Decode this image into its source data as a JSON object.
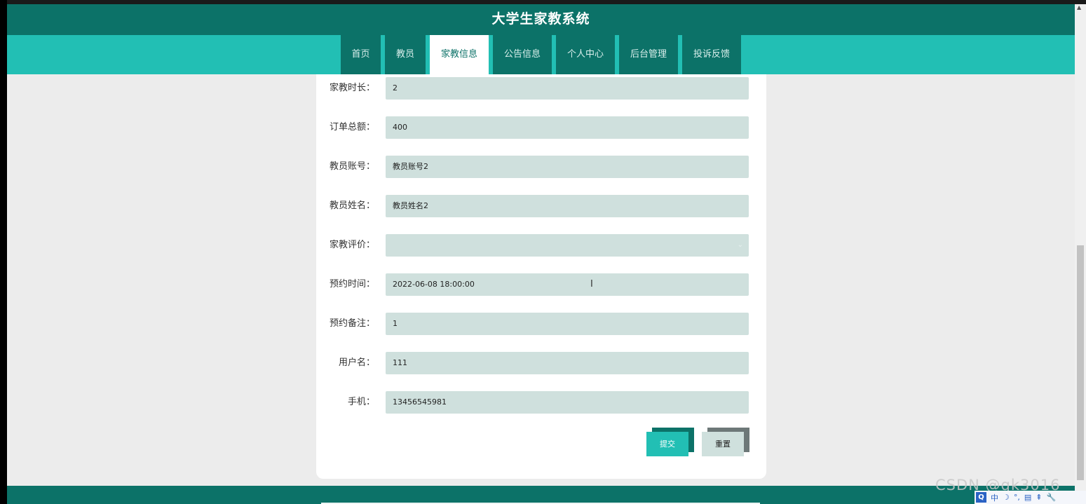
{
  "app": {
    "title": "大学生家教系统"
  },
  "nav": [
    "首页",
    "教员",
    "家教信息",
    "公告信息",
    "个人中心",
    "后台管理",
    "投诉反馈"
  ],
  "form": {
    "fields": [
      {
        "label": "家教时长：",
        "value": "2"
      },
      {
        "label": "订单总额：",
        "value": "400"
      },
      {
        "label": "教员账号：",
        "value": "教员账号2"
      },
      {
        "label": "教员姓名：",
        "value": "教员姓名2"
      },
      {
        "label": "家教评价：",
        "value": ""
      },
      {
        "label": "预约时间：",
        "value": "2022-06-08 18:00:00"
      },
      {
        "label": "预约备注：",
        "value": "1"
      },
      {
        "label": "用户名：",
        "value": "111"
      },
      {
        "label": "手机：",
        "value": "13456545981"
      }
    ],
    "submit_label": "提交",
    "reset_label": "重置"
  },
  "watermark": "CSDN @qk3016",
  "ime": [
    "Q",
    "中",
    "☽",
    "°,",
    "▤",
    "⇞",
    "🔧"
  ],
  "cursor": "I"
}
